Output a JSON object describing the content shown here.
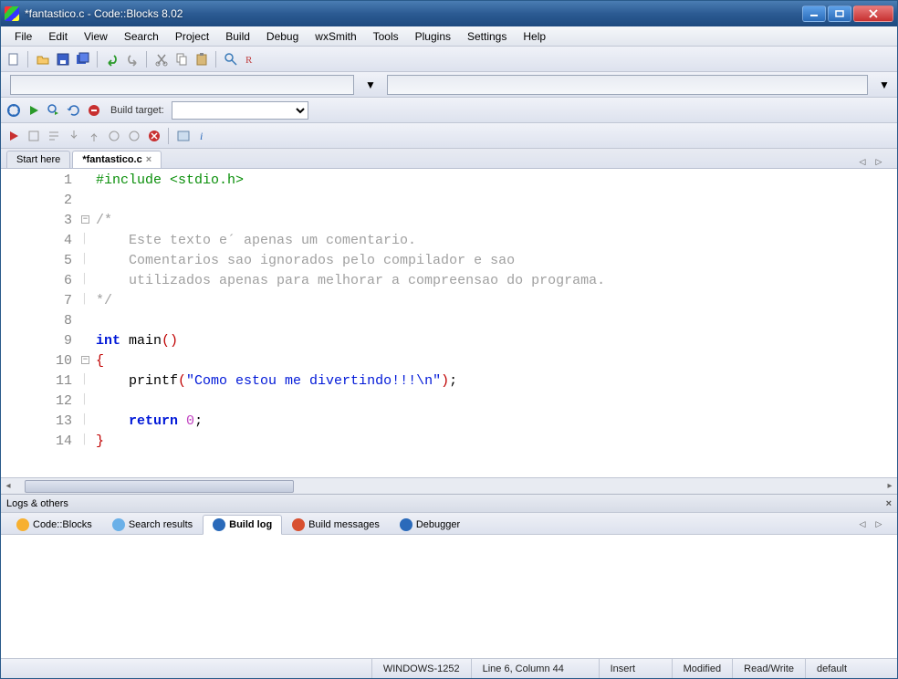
{
  "window": {
    "title": "*fantastico.c - Code::Blocks 8.02"
  },
  "menu": [
    "File",
    "Edit",
    "View",
    "Search",
    "Project",
    "Build",
    "Debug",
    "wxSmith",
    "Tools",
    "Plugins",
    "Settings",
    "Help"
  ],
  "toolbar2": {
    "build_target_label": "Build target:"
  },
  "tabs": {
    "items": [
      {
        "label": "Start here",
        "active": false
      },
      {
        "label": "*fantastico.c",
        "active": true
      }
    ]
  },
  "code": {
    "line_count": 14,
    "lines": [
      {
        "n": 1,
        "html": "<span class='cm-pre'>#include &lt;stdio.h&gt;</span>"
      },
      {
        "n": 2,
        "html": ""
      },
      {
        "n": 3,
        "html": "<span class='cm-com'>/*</span>"
      },
      {
        "n": 4,
        "html": "<span class='cm-com'>    Este texto e´ apenas um comentario.</span>"
      },
      {
        "n": 5,
        "html": "<span class='cm-com'>    Comentarios sao ignorados pelo compilador e sao</span>"
      },
      {
        "n": 6,
        "html": "<span class='cm-com'>    utilizados apenas para melhorar a compreensao do programa.</span>"
      },
      {
        "n": 7,
        "html": "<span class='cm-com'>*/</span>"
      },
      {
        "n": 8,
        "html": ""
      },
      {
        "n": 9,
        "html": "<span class='cm-kw'>int</span> main<span class='cm-par'>()</span>"
      },
      {
        "n": 10,
        "html": "<span class='cm-brace'>{</span>"
      },
      {
        "n": 11,
        "html": "    printf<span class='cm-par'>(</span><span class='cm-str'>\"Como estou me divertindo!!!\\n\"</span><span class='cm-par'>)</span>;"
      },
      {
        "n": 12,
        "html": ""
      },
      {
        "n": 13,
        "html": "    <span class='cm-kw'>return</span> <span class='cm-num'>0</span>;"
      },
      {
        "n": 14,
        "html": "<span class='cm-brace'>}</span>"
      }
    ]
  },
  "logs": {
    "title": "Logs & others",
    "tabs": [
      "Code::Blocks",
      "Search results",
      "Build log",
      "Build messages",
      "Debugger"
    ],
    "active_tab": "Build log"
  },
  "status": {
    "encoding": "WINDOWS-1252",
    "position": "Line 6, Column 44",
    "mode": "Insert",
    "modified": "Modified",
    "access": "Read/Write",
    "profile": "default"
  }
}
